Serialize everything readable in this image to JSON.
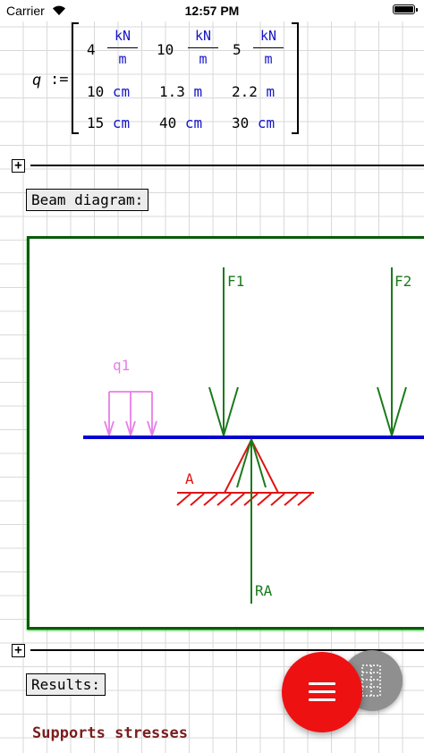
{
  "status_bar": {
    "carrier": "Carrier",
    "time": "12:57 PM"
  },
  "matrix": {
    "variable": "q",
    "operator": ":=",
    "row1": [
      {
        "value": "4",
        "num": "kN",
        "den": "m"
      },
      {
        "value": "10",
        "num": "kN",
        "den": "m"
      },
      {
        "value": "5",
        "num": "kN",
        "den": "m"
      }
    ],
    "row2": [
      {
        "value": "10",
        "unit": "cm"
      },
      {
        "value": "1.3",
        "unit": "m"
      },
      {
        "value": "2.2",
        "unit": "m"
      }
    ],
    "row3": [
      {
        "value": "15",
        "unit": "cm"
      },
      {
        "value": "40",
        "unit": "cm"
      },
      {
        "value": "30",
        "unit": "cm"
      }
    ]
  },
  "region_toggle_symbol": "+",
  "beam_label": "Beam diagram:",
  "diagram": {
    "labels": {
      "f1": "F1",
      "f2": "F2",
      "q1": "q1",
      "support": "A",
      "reaction": "RA"
    },
    "colors": {
      "frame": "#0a5a0a",
      "beam": "#0000d0",
      "force": "#1a7a1a",
      "load": "#e87de8",
      "support": "#e01414"
    }
  },
  "results_label": "Results:",
  "supports_heading": "Supports stresses",
  "fab": {
    "primary_color": "#ee1111",
    "primary_icon": "menu-icon",
    "secondary_color": "#8f8f8f",
    "secondary_icon": "grid-icon"
  }
}
